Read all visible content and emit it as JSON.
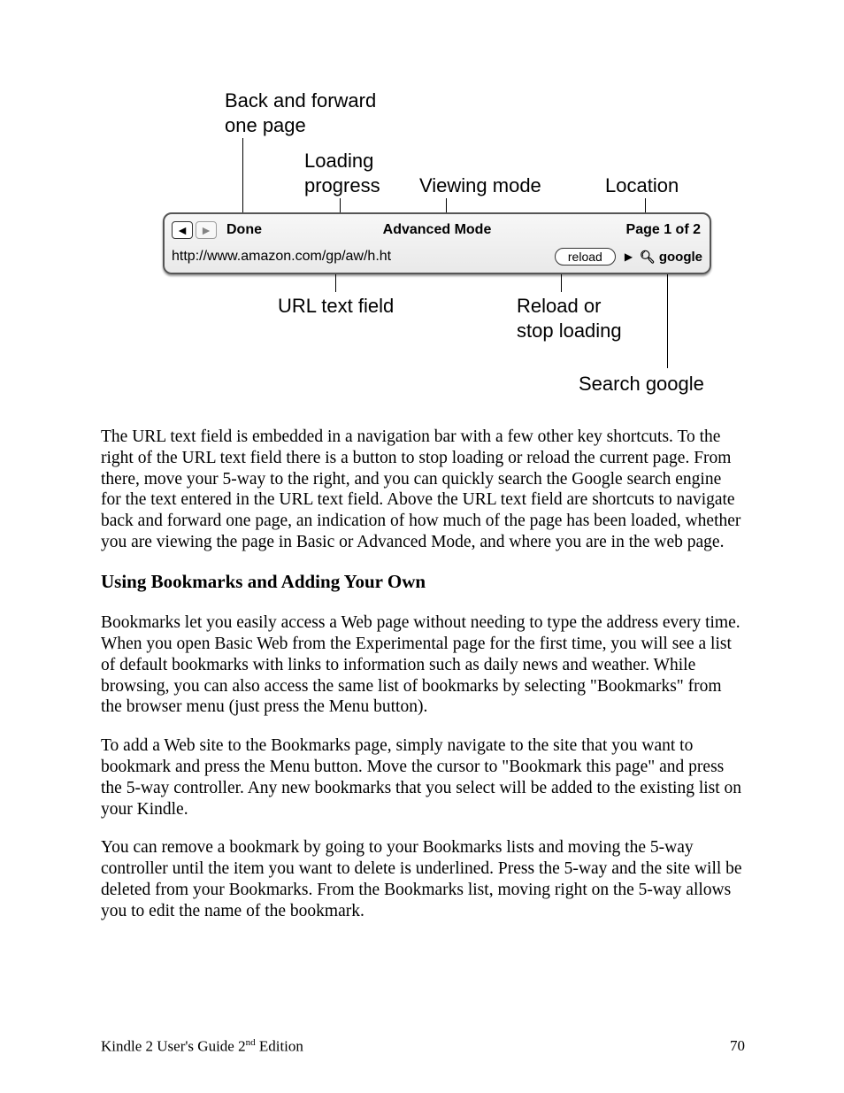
{
  "diagram": {
    "callouts": {
      "back_forward": "Back and forward\none page",
      "loading": "Loading\nprogress",
      "viewing_mode": "Viewing mode",
      "location": "Location",
      "url_field": "URL text field",
      "reload_stop": "Reload or\nstop loading",
      "search_google": "Search google"
    },
    "toolbar": {
      "done": "Done",
      "mode": "Advanced Mode",
      "page": "Page 1 of 2",
      "url": "http://www.amazon.com/gp/aw/h.ht",
      "reload": "reload",
      "search": "google"
    }
  },
  "paragraphs": {
    "p1": "The URL text field is embedded in a navigation bar with a few other key shortcuts. To the right of the URL text field there is a button to stop loading or reload the current page. From there, move your 5-way to the right, and you can quickly search the Google search engine for the text entered in the URL text field. Above the URL text field are shortcuts to navigate back and forward one page, an indication of how much of the page has been loaded, whether you are viewing the page in Basic or Advanced Mode, and where you are in the web page.",
    "heading": "Using Bookmarks and Adding Your Own",
    "p2": "Bookmarks let you easily access a Web page without needing to type the address every time. When you open Basic Web from the Experimental page for the first time, you will see a list of default bookmarks with links to information such as daily news and weather. While browsing, you can also access the same list of bookmarks by selecting \"Bookmarks\" from the browser menu (just press the Menu button).",
    "p3": "To add a Web site to the Bookmarks page, simply navigate to the site that you want to bookmark and press the Menu button. Move the cursor to \"Bookmark this page\" and press the 5-way controller. Any new bookmarks that you select will be added to the existing list on your Kindle.",
    "p4": "You can remove a bookmark by going to your Bookmarks lists and moving the 5-way controller until the item you want to delete is underlined. Press the 5-way and the site will be deleted from your Bookmarks. From the Bookmarks list, moving right on the 5-way allows you to edit the name of the bookmark."
  },
  "footer": {
    "title_a": "Kindle 2 User's Guide 2",
    "title_b": " Edition",
    "sup": "nd",
    "page": "70"
  }
}
